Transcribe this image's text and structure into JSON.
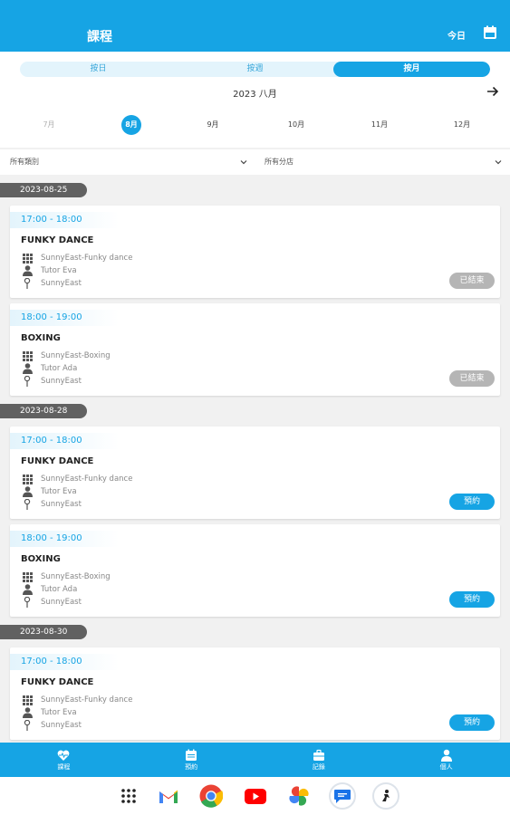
{
  "header": {
    "title": "課程",
    "today_label": "今日"
  },
  "segments": [
    "按日",
    "按週",
    "按月"
  ],
  "month_title": "2023 八月",
  "months": [
    "7月",
    "8月",
    "9月",
    "10月",
    "11月",
    "12月"
  ],
  "filters": {
    "category": "所有類別",
    "branch": "所有分店"
  },
  "groups": [
    {
      "date": "2023-08-25"
    },
    {
      "date": "2023-08-28"
    },
    {
      "date": "2023-08-30"
    }
  ],
  "cards": [
    {
      "time": "17:00 - 18:00",
      "name": "FUNKY DANCE",
      "class": "SunnyEast-Funky dance",
      "tutor": "Tutor Eva",
      "location": "SunnyEast",
      "status": "已結束"
    },
    {
      "time": "18:00 - 19:00",
      "name": "BOXING",
      "class": "SunnyEast-Boxing",
      "tutor": "Tutor Ada",
      "location": "SunnyEast",
      "status": "已結束"
    },
    {
      "time": "17:00 - 18:00",
      "name": "FUNKY DANCE",
      "class": "SunnyEast-Funky dance",
      "tutor": "Tutor Eva",
      "location": "SunnyEast",
      "status": "預約"
    },
    {
      "time": "18:00 - 19:00",
      "name": "BOXING",
      "class": "SunnyEast-Boxing",
      "tutor": "Tutor Ada",
      "location": "SunnyEast",
      "status": "預約"
    },
    {
      "time": "17:00 - 18:00",
      "name": "FUNKY DANCE",
      "class": "SunnyEast-Funky dance",
      "tutor": "Tutor Eva",
      "location": "SunnyEast",
      "status": "預約"
    }
  ],
  "bottom_nav": [
    "課程",
    "預約",
    "記錄",
    "個人"
  ],
  "colors": {
    "primary": "#16a4e4",
    "ended": "#b5b5b5",
    "badge": "#616161"
  }
}
